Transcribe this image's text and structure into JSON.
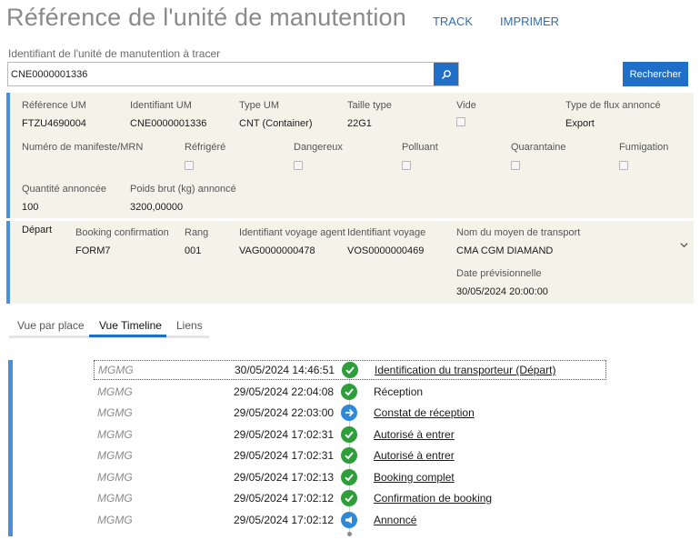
{
  "header": {
    "title": "Référence de l'unité de manutention",
    "nav": [
      "TRACK",
      "IMPRIMER"
    ]
  },
  "search": {
    "label": "Identifiant de l'unité de manutention à tracer",
    "value": "CNE0000001336",
    "button_label": "Rechercher"
  },
  "details": {
    "reference_um": {
      "label": "Référence UM",
      "value": "FTZU4690004"
    },
    "identifiant_um": {
      "label": "Identifiant UM",
      "value": "CNE0000001336"
    },
    "type_um": {
      "label": "Type UM",
      "value": "CNT (Container)"
    },
    "taille_type": {
      "label": "Taille type",
      "value": "22G1"
    },
    "vide": {
      "label": "Vide",
      "checked": false
    },
    "type_flux": {
      "label": "Type de flux annoncé",
      "value": "Export"
    },
    "manifeste": {
      "label": "Numéro de manifeste/MRN",
      "value": ""
    },
    "refrigere": {
      "label": "Réfrigéré",
      "checked": false
    },
    "dangereux": {
      "label": "Dangereux",
      "checked": false
    },
    "polluant": {
      "label": "Polluant",
      "checked": false
    },
    "quarantaine": {
      "label": "Quarantaine",
      "checked": false
    },
    "fumigation": {
      "label": "Fumigation",
      "checked": false
    },
    "quantite": {
      "label": "Quantité annoncée",
      "value": "100"
    },
    "poids": {
      "label": "Poids brut (kg) annoncé",
      "value": "3200,00000"
    }
  },
  "depart": {
    "section_label": "Départ",
    "booking": {
      "label": "Booking confirmation",
      "value": "FORM7"
    },
    "rang": {
      "label": "Rang",
      "value": "001"
    },
    "voyage_agent": {
      "label": "Identifiant voyage agent",
      "value": "VAG0000000478"
    },
    "voyage": {
      "label": "Identifiant voyage",
      "value": "VOS0000000469"
    },
    "transport": {
      "label": "Nom du moyen de transport",
      "value": "CMA CGM DIAMAND"
    },
    "date_prev": {
      "label": "Date prévisionnelle",
      "value": "30/05/2024 20:00:00"
    }
  },
  "tabs": [
    "Vue par place",
    "Vue Timeline",
    "Liens"
  ],
  "active_tab": "Vue Timeline",
  "timeline": [
    {
      "actor": "MGMG",
      "date": "30/05/2024 14:46:51",
      "icon": "check-icon",
      "label": "Identification du transporteur (Départ)",
      "link": true
    },
    {
      "actor": "MGMG",
      "date": "29/05/2024 22:04:08",
      "icon": "check-icon",
      "label": "Réception",
      "link": false
    },
    {
      "actor": "MGMG",
      "date": "29/05/2024 22:03:00",
      "icon": "arrow-right-icon",
      "label": "Constat de réception",
      "link": true
    },
    {
      "actor": "MGMG",
      "date": "29/05/2024 17:02:31",
      "icon": "check-icon",
      "label": "Autorisé à entrer",
      "link": true
    },
    {
      "actor": "MGMG",
      "date": "29/05/2024 17:02:31",
      "icon": "check-icon",
      "label": "Autorisé à entrer",
      "link": true
    },
    {
      "actor": "MGMG",
      "date": "29/05/2024 17:02:13",
      "icon": "check-icon",
      "label": "Booking complet",
      "link": true
    },
    {
      "actor": "MGMG",
      "date": "29/05/2024 17:02:12",
      "icon": "check-icon",
      "label": "Confirmation de booking",
      "link": true
    },
    {
      "actor": "MGMG",
      "date": "29/05/2024 17:02:12",
      "icon": "megaphone-icon",
      "label": "Annoncé",
      "link": true
    }
  ],
  "colors": {
    "accent": "#1f6fc9",
    "panel_bg": "#f3f3ea",
    "panel_border": "#4a90d9",
    "ok": "#2e9e3a",
    "info": "#2e89d8"
  }
}
